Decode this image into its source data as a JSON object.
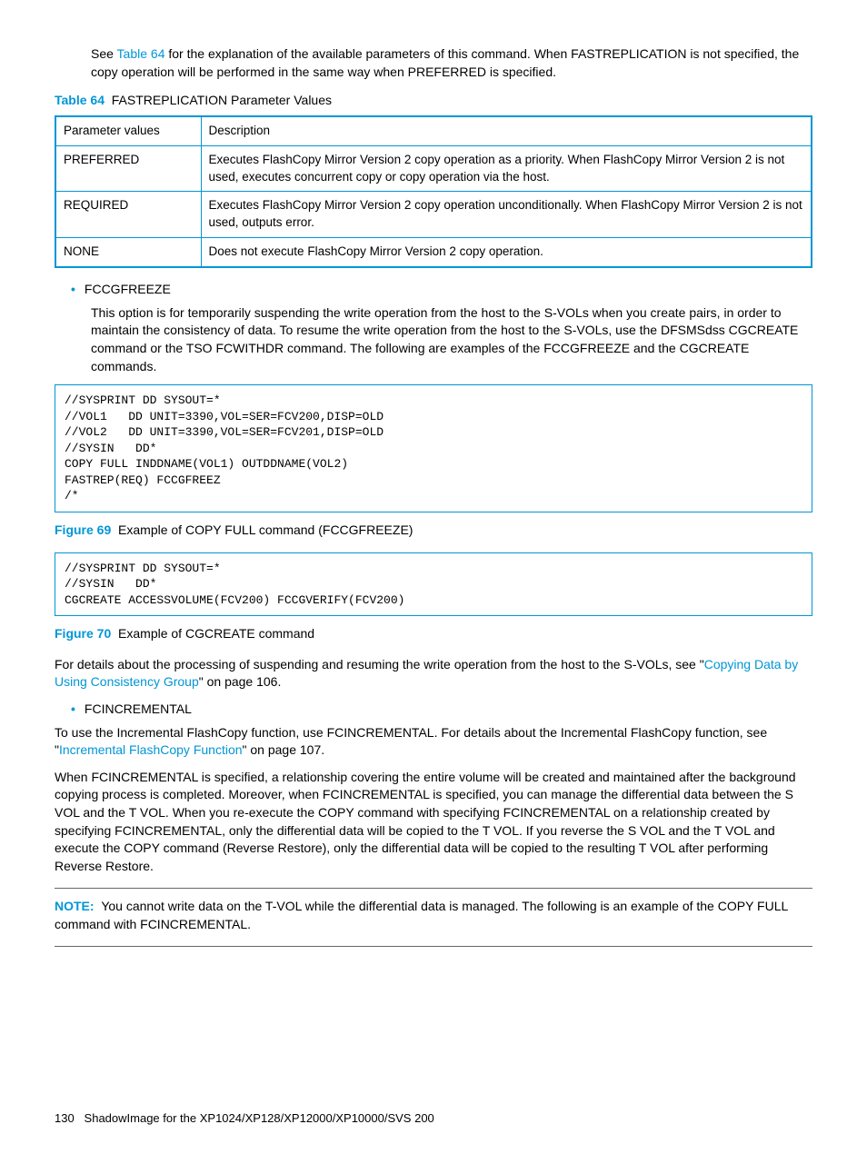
{
  "intro": {
    "p1_a": "See ",
    "p1_link": "Table 64",
    "p1_b": " for the explanation of the available parameters of this command. When FASTREPLICATION is not specified, the copy operation will be performed in the same way when PREFERRED is specified."
  },
  "table64": {
    "caption_label": "Table 64",
    "caption_text": "FASTREPLICATION Parameter Values",
    "head": {
      "col1": "Parameter values",
      "col2": "Description"
    },
    "rows": [
      {
        "c1": "PREFERRED",
        "c2": "Executes FlashCopy Mirror Version 2 copy operation as a priority. When FlashCopy Mirror Version 2 is not used, executes concurrent copy or copy operation via the host."
      },
      {
        "c1": "REQUIRED",
        "c2": "Executes FlashCopy Mirror Version 2 copy operation unconditionally. When FlashCopy Mirror Version 2 is not used, outputs error."
      },
      {
        "c1": "NONE",
        "c2": "Does not execute FlashCopy Mirror Version 2 copy operation."
      }
    ]
  },
  "bullets": {
    "fccgfreeze": {
      "title": "FCCGFREEZE",
      "desc": "This option is for temporarily suspending the write operation from the host to the S-VOLs when you create pairs, in order to maintain the consistency of data. To resume the write operation from the host to the S-VOLs, use the DFSMSdss CGCREATE command or the TSO FCWITHDR command. The following are examples of the FCCGFREEZE and the CGCREATE commands."
    },
    "fcincremental": {
      "title": "FCINCREMENTAL"
    }
  },
  "code69": "//SYSPRINT DD SYSOUT=*\n//VOL1   DD UNIT=3390,VOL=SER=FCV200,DISP=OLD\n//VOL2   DD UNIT=3390,VOL=SER=FCV201,DISP=OLD\n//SYSIN   DD*\nCOPY FULL INDDNAME(VOL1) OUTDDNAME(VOL2)\nFASTREP(REQ) FCCGFREEZ\n/*",
  "fig69": {
    "label": "Figure 69",
    "text": "Example of COPY FULL command (FCCGFREEZE)"
  },
  "code70": "//SYSPRINT DD SYSOUT=*\n//SYSIN   DD*\nCGCREATE ACCESSVOLUME(FCV200) FCCGVERIFY(FCV200)",
  "fig70": {
    "label": "Figure 70",
    "text": "Example of CGCREATE command"
  },
  "para_after70": {
    "a": "For details about the processing of suspending and resuming the write operation from the host to the S-VOLs, see \"",
    "link": "Copying Data by Using Consistency Group",
    "b": "\" on page 106."
  },
  "para_fcincremental": {
    "a": "To use the Incremental FlashCopy function, use FCINCREMENTAL. For details about the Incremental FlashCopy function, see \"",
    "link": "Incremental FlashCopy Function",
    "b": "\" on page 107."
  },
  "para_fc2": "When FCINCREMENTAL is specified, a relationship covering the entire volume will be created and maintained after the background copying process is completed. Moreover, when FCINCREMENTAL is specified, you can manage the differential data between the S VOL and the T VOL. When you re-execute the COPY command with specifying FCINCREMENTAL on a relationship created by specifying FCINCREMENTAL, only the differential data will be copied to the T VOL. If you reverse the S VOL and the T VOL and execute the COPY command (Reverse Restore), only the differential data will be copied to the resulting T VOL after performing Reverse Restore.",
  "note": {
    "label": "NOTE:",
    "text": "You cannot write data on the T-VOL while the differential data is managed. The following is an example of the COPY FULL command with FCINCREMENTAL."
  },
  "footer": {
    "page": "130",
    "title": "ShadowImage for the XP1024/XP128/XP12000/XP10000/SVS 200"
  }
}
